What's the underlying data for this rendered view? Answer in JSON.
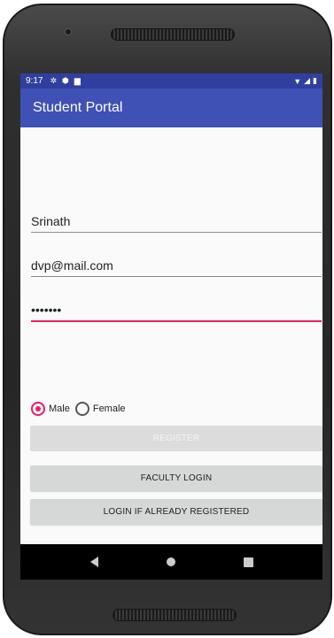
{
  "status_bar": {
    "time": "9:17",
    "icons_left": [
      "gear-icon",
      "shield-icon",
      "sdcard-icon"
    ],
    "icons_right": [
      "wifi-icon",
      "signal-icon",
      "battery-icon"
    ]
  },
  "app_bar": {
    "title": "Student Portal"
  },
  "form": {
    "name_value": "Srinath",
    "email_value": "dvp@mail.com",
    "password_value": "•••••••",
    "gender": {
      "options": [
        "Male",
        "Female"
      ],
      "selected": "Male"
    }
  },
  "buttons": {
    "register": "REGISTER",
    "faculty_login": "FACULTY LOGIN",
    "login_registered": "LOGIN IF ALREADY REGISTERED"
  },
  "colors": {
    "status_bar": "#303f9f",
    "app_bar": "#3f51b5",
    "accent": "#e91e63"
  }
}
